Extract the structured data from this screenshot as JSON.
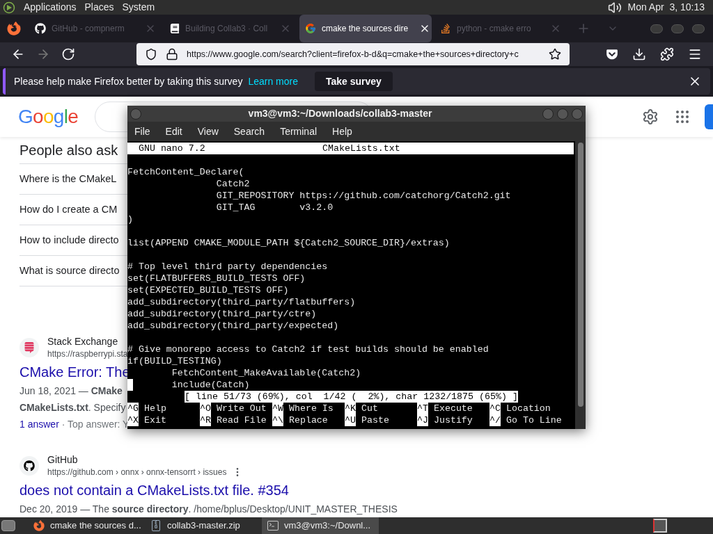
{
  "top_panel": {
    "menus": [
      "Applications",
      "Places",
      "System"
    ],
    "clock": "Mon Apr  3, 10:13"
  },
  "browser": {
    "tabs": [
      {
        "kind": "github",
        "label": "GitHub - compnerm",
        "selected": false
      },
      {
        "kind": "book",
        "label": "Building Collab3 · Coll",
        "selected": false
      },
      {
        "kind": "google",
        "label": "cmake the sources dire",
        "selected": true
      },
      {
        "kind": "stack",
        "label": "python - cmake erro",
        "selected": false
      }
    ],
    "url": "https://www.google.com/search?client=firefox-b-d&q=cmake+the+sources+directory+c",
    "survey": {
      "message": "Please help make Firefox better by taking this survey",
      "link": "Learn more",
      "button": "Take survey"
    }
  },
  "page": {
    "logo": "Google",
    "people_also_ask": {
      "title": "People also ask",
      "questions": [
        "Where is the CMakeL",
        "How do I create a CM",
        "How to include directo",
        "What is source directo"
      ]
    },
    "results": [
      {
        "kind": "stack",
        "site": "Stack Exchange",
        "url": "https://raspberrypi.sta",
        "title": "CMake Error: The",
        "lines": [
          "Jun 18, 2021 — **CMake**",
          "**CMakeLists.txt**. Specify"
        ],
        "answers": "1 answer",
        "answers_rest": " · Top answer: Y"
      },
      {
        "kind": "github",
        "site": "GitHub",
        "url": "https://github.com › onnx › onnx-tensorrt › issues",
        "title": "does not contain a CMakeLists.txt file. #354",
        "lines": [
          "Dec 20, 2019 — The **source directory**. /home/bplus/Desktop/UNIT_MASTER_THESIS"
        ]
      }
    ]
  },
  "terminal": {
    "title": "vm3@vm3:~/Downloads/collab3-master",
    "menus": [
      "File",
      "Edit",
      "View",
      "Search",
      "Terminal",
      "Help"
    ],
    "nano": {
      "version": "  GNU nano 7.2",
      "file": "CMakeLists.txt",
      "lines": [
        {
          "kind": "blank"
        },
        {
          "kind": "text",
          "text": "FetchContent_Declare("
        },
        {
          "kind": "text",
          "text": "                Catch2"
        },
        {
          "kind": "text",
          "text": "                GIT_REPOSITORY https://github.com/catchorg/Catch2.git"
        },
        {
          "kind": "text",
          "text": "                GIT_TAG        v3.2.0"
        },
        {
          "kind": "text",
          "text": ")"
        },
        {
          "kind": "blank"
        },
        {
          "kind": "text",
          "text": "list(APPEND CMAKE_MODULE_PATH ${Catch2_SOURCE_DIR}/extras)"
        },
        {
          "kind": "blank"
        },
        {
          "kind": "text",
          "text": "# Top level third party dependencies"
        },
        {
          "kind": "text",
          "text": "set(FLATBUFFERS_BUILD_TESTS OFF)"
        },
        {
          "kind": "text",
          "text": "set(EXPECTED_BUILD_TESTS OFF)"
        },
        {
          "kind": "text",
          "text": "add_subdirectory(third_party/flatbuffers)"
        },
        {
          "kind": "text",
          "text": "add_subdirectory(third_party/ctre)"
        },
        {
          "kind": "text",
          "text": "add_subdirectory(third_party/expected)"
        },
        {
          "kind": "blank"
        },
        {
          "kind": "text",
          "text": "# Give monorepo access to Catch2 if test builds should be enabled"
        },
        {
          "kind": "text",
          "text": "if(BUILD_TESTING)"
        },
        {
          "kind": "text",
          "text": "        FetchContent_MakeAvailable(Catch2)"
        },
        {
          "kind": "cursor",
          "text": "       include(Catch)"
        }
      ],
      "status": "[ line 51/73 (69%), col  1/42 (  2%), char 1232/1875 (65%) ]",
      "shortcuts": [
        [
          {
            "key": "^G",
            "label": "Help"
          },
          {
            "key": "^O",
            "label": "Write Out"
          },
          {
            "key": "^W",
            "label": "Where Is"
          },
          {
            "key": "^K",
            "label": "Cut"
          },
          {
            "key": "^T",
            "label": "Execute"
          },
          {
            "key": "^C",
            "label": "Location"
          }
        ],
        [
          {
            "key": "^X",
            "label": "Exit"
          },
          {
            "key": "^R",
            "label": "Read File"
          },
          {
            "key": "^\\",
            "label": "Replace"
          },
          {
            "key": "^U",
            "label": "Paste"
          },
          {
            "key": "^J",
            "label": "Justify"
          },
          {
            "key": "^/",
            "label": "Go To Line"
          }
        ]
      ]
    }
  },
  "taskbar": [
    {
      "kind": "firefox",
      "label": "cmake the sources d...",
      "selected": false
    },
    {
      "kind": "archive",
      "label": "collab3-master.zip",
      "selected": false
    },
    {
      "kind": "terminal",
      "label": "vm3@vm3:~/Downl...",
      "selected": true
    }
  ]
}
